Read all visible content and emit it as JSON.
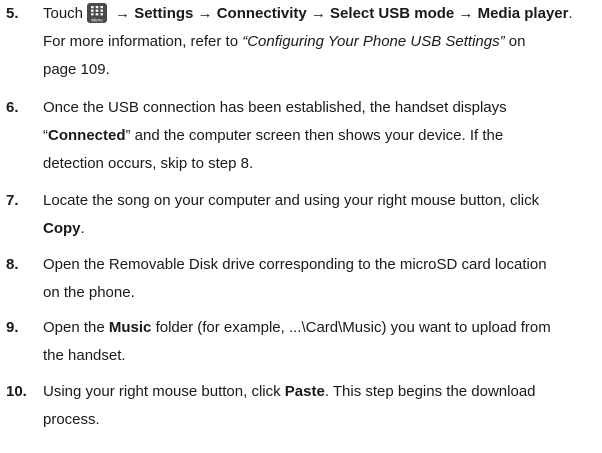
{
  "steps": [
    {
      "num": "5.",
      "touch": "Touch",
      "menu_icon_label": "Menu",
      "path": "→ Settings → Connectivity → Select USB mode → Media player",
      "path_end": ".",
      "info_pre": "For more information, refer to ",
      "info_ref": "“Configuring Your Phone USB Settings”",
      "info_mid": " on",
      "info_page": "page 109."
    },
    {
      "num": "6.",
      "line1": "Once the USB connection has been established, the handset displays",
      "line2_pre": "“",
      "line2_bold": "Connected",
      "line2_post": "” and the computer screen then shows your device. If the",
      "line3": "detection occurs, skip to step 8."
    },
    {
      "num": "7.",
      "line1": "Locate the song on your computer and using your right mouse button, click",
      "line2_bold": "Copy",
      "line2_post": "."
    },
    {
      "num": "8.",
      "line1": "Open the Removable Disk drive corresponding to the microSD card location",
      "line2": "on the phone."
    },
    {
      "num": "9.",
      "line1_pre": "Open the ",
      "line1_bold": "Music",
      "line1_post": " folder (for example, ...\\Card\\Music) you want to upload from",
      "line2": "the handset."
    },
    {
      "num": "10.",
      "line1_pre": "Using your right mouse button, click ",
      "line1_bold": "Paste",
      "line1_post": ". This step begins the download",
      "line2": "process."
    }
  ]
}
